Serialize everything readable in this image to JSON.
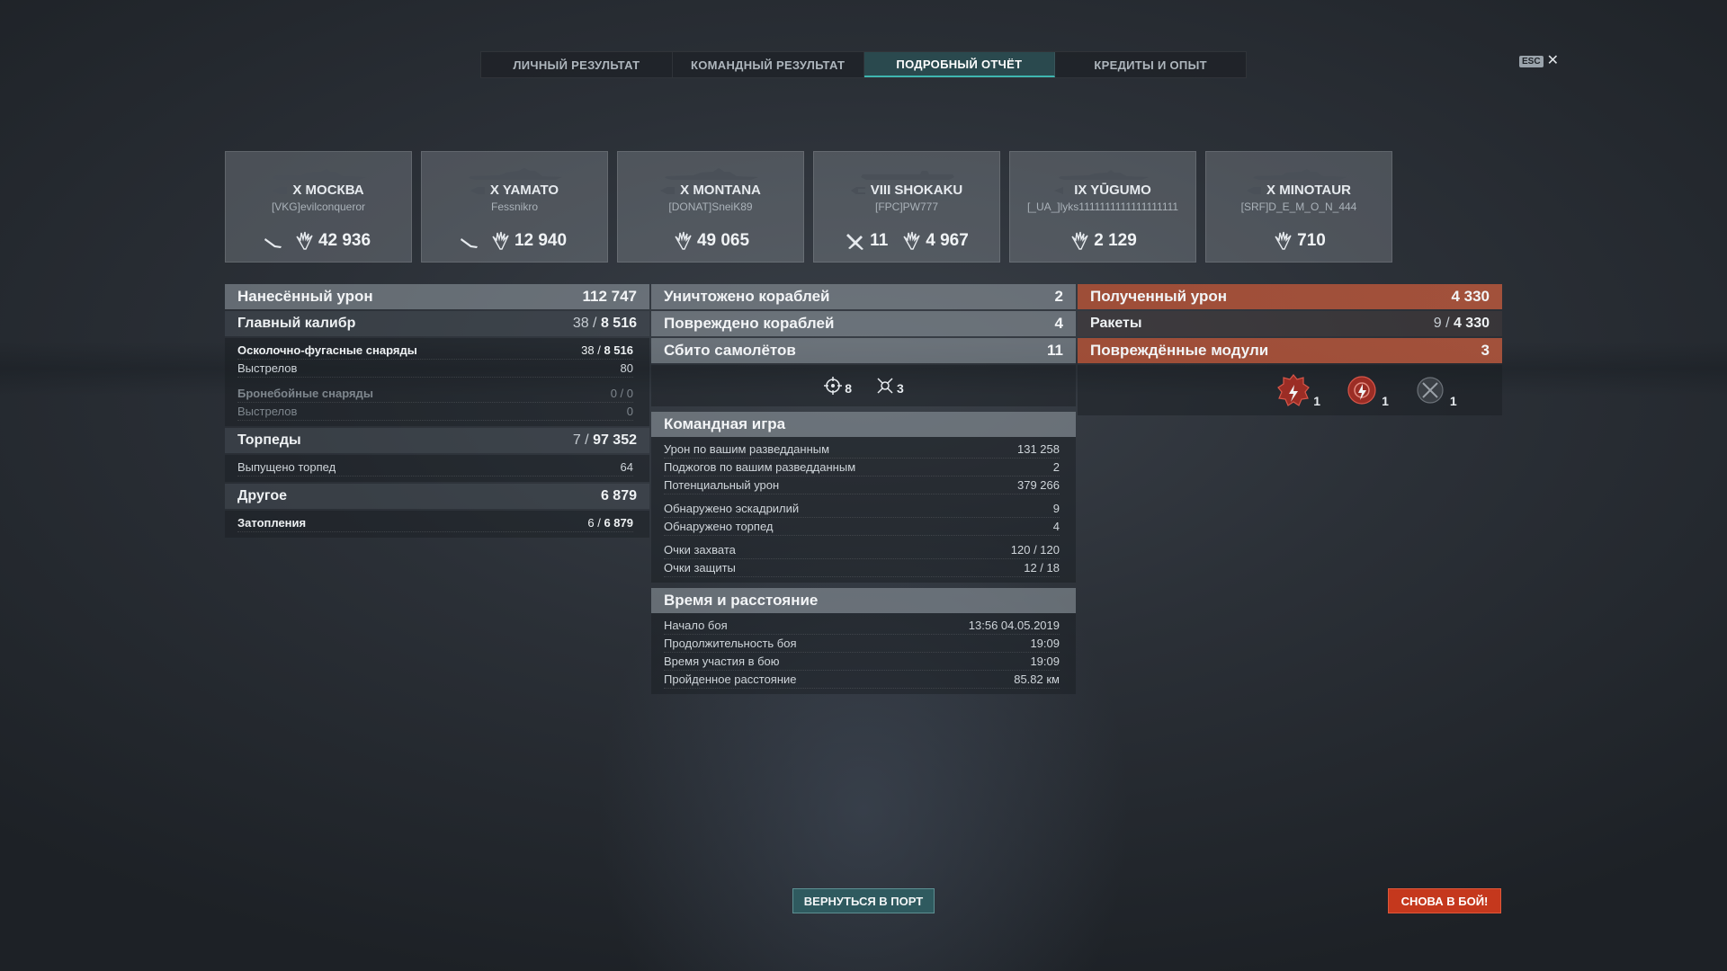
{
  "tabs": [
    {
      "label": "ЛИЧНЫЙ РЕЗУЛЬТАТ"
    },
    {
      "label": "КОМАНДНЫЙ РЕЗУЛЬТАТ"
    },
    {
      "label": "ПОДРОБНЫЙ ОТЧЁТ"
    },
    {
      "label": "КРЕДИТЫ И ОПЫТ"
    }
  ],
  "esc_label": "ESC",
  "close_glyph": "✕",
  "ships": [
    {
      "name": "X МОСКВА",
      "player": "[VKG]evilconqueror",
      "stat1": "",
      "damage": "42 936",
      "icons": [
        "torpedo-icon"
      ]
    },
    {
      "name": "X YAMATO",
      "player": "Fessnikro",
      "stat1": "",
      "damage": "12 940",
      "icons": [
        "torpedo-icon"
      ]
    },
    {
      "name": "X MONTANA",
      "player": "[DONAT]SneiK89",
      "stat1": "",
      "damage": "49 065",
      "icons": []
    },
    {
      "name": "VIII SHOKAKU",
      "player": "[FPC]PW777",
      "stat1": "11",
      "damage": "4 967",
      "icons": [
        "plane-icon"
      ]
    },
    {
      "name": "IX YŪGUMO",
      "player": "[_UA_]lyks1111111111111111111",
      "stat1": "",
      "damage": "2 129",
      "icons": []
    },
    {
      "name": "X MINOTAUR",
      "player": "[SRF]D_E_M_O_N_444",
      "stat1": "",
      "damage": "710",
      "icons": []
    }
  ],
  "left": {
    "dealt_label": "Нанесённый урон",
    "dealt_value": "112 747",
    "main_label": "Главный калибр",
    "main_hits": "38 / ",
    "main_value": "8 516",
    "he_label": "Осколочно-фугасные снаряды",
    "he_hits": "38 / ",
    "he_value": "8 516",
    "he_shots_label": "Выстрелов",
    "he_shots": "80",
    "ap_label": "Бронебойные снаряды",
    "ap_value": "0 / 0",
    "ap_shots_label": "Выстрелов",
    "ap_shots": "0",
    "torp_label": "Торпеды",
    "torp_hits": "7 / ",
    "torp_value": "97 352",
    "torp_fired_label": "Выпущено торпед",
    "torp_fired": "64",
    "other_label": "Другое",
    "other_value": "6 879",
    "flood_label": "Затопления",
    "flood_hits": "6 / ",
    "flood_value": "6 879"
  },
  "mid": {
    "destroyed_label": "Уничтожено кораблей",
    "destroyed": "2",
    "damaged_label": "Повреждено кораблей",
    "damaged": "4",
    "planes_label": "Сбито самолётов",
    "planes": "11",
    "icon1_count": "8",
    "icon2_count": "3",
    "team_title": "Командная игра",
    "team_rows": [
      {
        "label": "Урон по вашим разведданным",
        "value": "131 258"
      },
      {
        "label": "Поджогов по вашим разведданным",
        "value": "2"
      },
      {
        "label": "Потенциальный урон",
        "value": "379 266"
      },
      {
        "label": "Обнаружено эскадрилий",
        "value": "9"
      },
      {
        "label": "Обнаружено торпед",
        "value": "4"
      },
      {
        "label": "Очки захвата",
        "value": "120 / 120"
      },
      {
        "label": "Очки защиты",
        "value": "12 / 18"
      }
    ],
    "time_title": "Время и расстояние",
    "time_rows": [
      {
        "label": "Начало боя",
        "value": "13:56  04.05.2019"
      },
      {
        "label": "Продолжительность боя",
        "value": "19:09"
      },
      {
        "label": "Время участия в бою",
        "value": "19:09"
      },
      {
        "label": "Пройденное расстояние",
        "value": "85.82 км"
      }
    ]
  },
  "right": {
    "received_label": "Полученный урон",
    "received_value": "4 330",
    "rockets_label": "Ракеты",
    "rockets_hits": "9 / ",
    "rockets_value": "4 330",
    "modules_label": "Повреждённые модули",
    "modules_value": "3",
    "module_counts": [
      "1",
      "1",
      "1"
    ]
  },
  "buttons": {
    "port": "ВЕРНУТЬСЯ В ПОРТ",
    "battle": "СНОВА В БОЙ!"
  },
  "colors": {
    "accent_teal": "#3fb6b0",
    "battle_red": "#c5381d",
    "received_orange": "#aa5037"
  }
}
